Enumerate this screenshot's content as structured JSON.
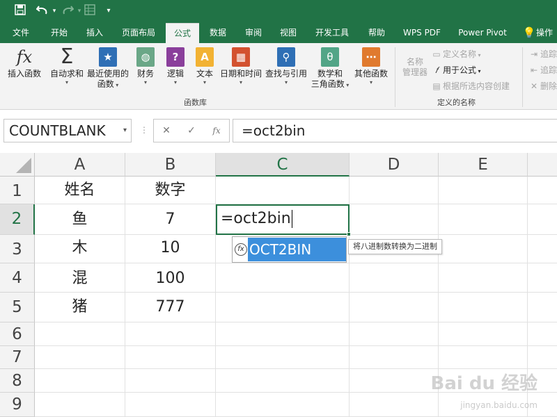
{
  "quick_access": {
    "save_icon": "save-icon",
    "undo_icon": "undo-icon",
    "redo_icon": "redo-icon",
    "form_icon": "form-icon",
    "customize_icon": "customize-quick-access-icon"
  },
  "tabs": [
    {
      "label": "文件"
    },
    {
      "label": "开始"
    },
    {
      "label": "插入"
    },
    {
      "label": "页面布局"
    },
    {
      "label": "公式"
    },
    {
      "label": "数据"
    },
    {
      "label": "审阅"
    },
    {
      "label": "视图"
    },
    {
      "label": "开发工具"
    },
    {
      "label": "帮助"
    },
    {
      "label": "WPS PDF"
    },
    {
      "label": "Power Pivot"
    },
    {
      "label": "操作"
    }
  ],
  "active_tab": "公式",
  "ribbon": {
    "function_library": {
      "group_label": "函数库",
      "insert_function": "插入函数",
      "autosum": "自动求和",
      "recently_used_line1": "最近使用的",
      "recently_used_line2": "函数",
      "financial": "财务",
      "logical": "逻辑",
      "text": "文本",
      "date_time": "日期和时间",
      "lookup_reference": "查找与引用",
      "math_trig_line1": "数学和",
      "math_trig_line2": "三角函数",
      "more_functions": "其他函数"
    },
    "defined_names": {
      "group_label": "定义的名称",
      "name_manager_line1": "名称",
      "name_manager_line2": "管理器",
      "define_name": "定义名称",
      "use_in_formula": "用于公式",
      "create_from_selection": "根据所选内容创建"
    },
    "formula_auditing": {
      "trace_precedents": "追踪",
      "trace_dependents": "追踪",
      "remove_arrows": "删除"
    }
  },
  "formula_bar": {
    "name_box": "COUNTBLANK",
    "formula": "=oct2bin"
  },
  "columns": [
    "A",
    "B",
    "C",
    "D",
    "E"
  ],
  "rows": [
    {
      "num": "1",
      "a": "姓名",
      "b": "数字"
    },
    {
      "num": "2",
      "a": "鱼",
      "b": "7"
    },
    {
      "num": "3",
      "a": "木",
      "b": "10"
    },
    {
      "num": "4",
      "a": "混",
      "b": "100"
    },
    {
      "num": "5",
      "a": "猪",
      "b": "777"
    },
    {
      "num": "6",
      "a": "",
      "b": ""
    },
    {
      "num": "7",
      "a": "",
      "b": ""
    },
    {
      "num": "8",
      "a": "",
      "b": ""
    },
    {
      "num": "9",
      "a": "",
      "b": ""
    }
  ],
  "active_cell": {
    "ref": "C2",
    "content": "=oct2bin"
  },
  "autocomplete": {
    "item": "OCT2BIN",
    "tooltip": "将八进制数转换为二进制"
  },
  "watermark": {
    "brand": "Bai du 经验",
    "url": "jingyan.baidu.com"
  },
  "colors": {
    "accent": "#217346",
    "selection": "#3c8fdc"
  }
}
